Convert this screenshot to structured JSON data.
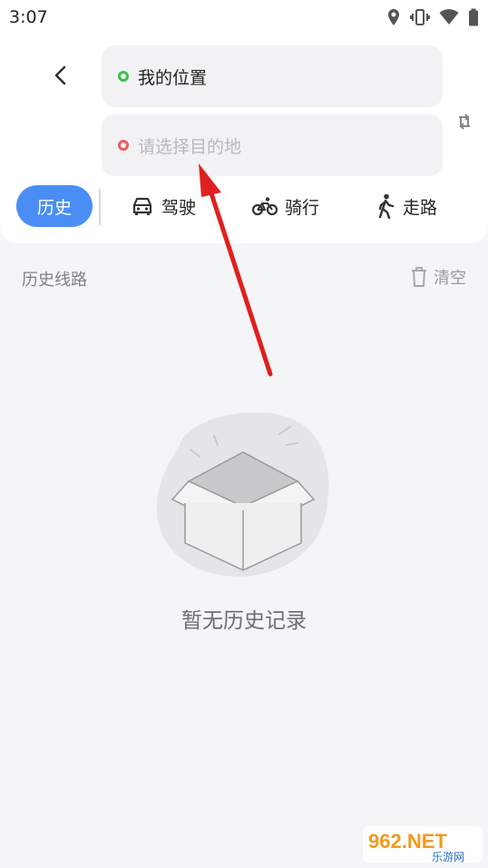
{
  "status": {
    "time": "3:07"
  },
  "route": {
    "origin": "我的位置",
    "destination_placeholder": "请选择目的地"
  },
  "modes": {
    "history": "历史",
    "drive": "驾驶",
    "ride": "骑行",
    "walk": "走路"
  },
  "history": {
    "title": "历史线路",
    "clear": "清空",
    "empty": "暂无历史记录"
  },
  "watermark": {
    "brand": "962.NET",
    "sub": "乐游网"
  },
  "colors": {
    "accent": "#4a8ef5",
    "origin_dot": "#38c24a",
    "dest_dot": "#f05b5b",
    "annotation_arrow": "#e02020"
  },
  "icons": [
    "location-icon",
    "vibrate-icon",
    "wifi-icon",
    "battery-icon",
    "back-icon",
    "swap-icon",
    "car-icon",
    "bike-icon",
    "walk-icon",
    "trash-icon",
    "empty-box-icon"
  ]
}
